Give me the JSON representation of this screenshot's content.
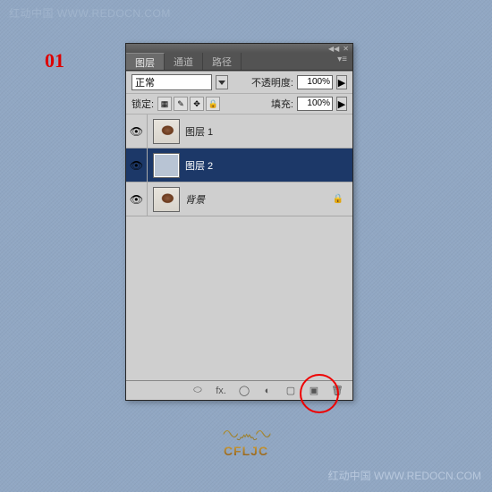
{
  "watermark": {
    "tl": "红动中国 WWW.REDOCN.COM",
    "br": "红动中国 WWW.REDOCN.COM"
  },
  "step": "01",
  "panel": {
    "tabs": {
      "layers": "图层",
      "channels": "通道",
      "paths": "路径"
    },
    "blend_mode": "正常",
    "opacity_label": "不透明度:",
    "opacity_value": "100%",
    "lock_label": "锁定:",
    "fill_label": "填充:",
    "fill_value": "100%",
    "layers": [
      {
        "name": "图层 1",
        "visible": true,
        "thumb": "t1"
      },
      {
        "name": "图层 2",
        "visible": true,
        "thumb": "t2",
        "selected": true
      },
      {
        "name": "背景",
        "visible": true,
        "thumb": "t3",
        "locked": true,
        "italic": true
      }
    ],
    "footer_icons": {
      "link": "⬭",
      "fx": "fx.",
      "mask": "◯",
      "adjust": "◐",
      "folder": "▢",
      "new": "▣",
      "trash": "🗑"
    }
  },
  "logo": {
    "ornament": "∿෴∿",
    "text": "CFLJC"
  }
}
